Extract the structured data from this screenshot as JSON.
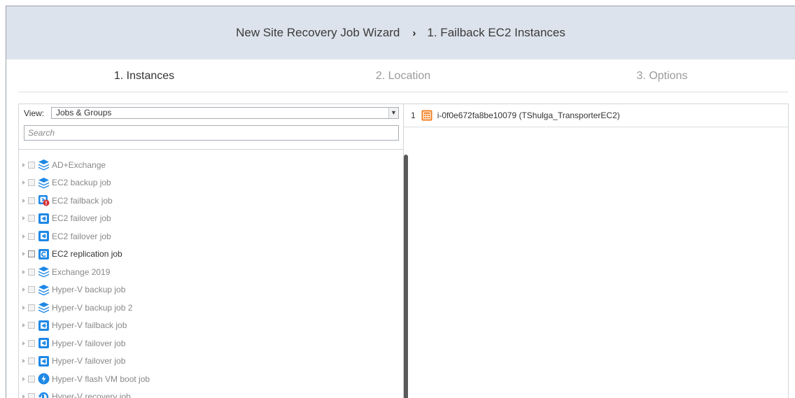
{
  "wizard": {
    "title": "New Site Recovery Job Wizard",
    "separator": "›",
    "subtitle": "1. Failback EC2 Instances"
  },
  "steps": [
    {
      "label": "1. Instances",
      "active": true
    },
    {
      "label": "2. Location",
      "active": false
    },
    {
      "label": "3. Options",
      "active": false
    }
  ],
  "left_pane": {
    "view_label": "View:",
    "view_value": "Jobs & Groups",
    "search_placeholder": "Search",
    "items": [
      {
        "label": "AD+Exchange",
        "icon": "stack-icon"
      },
      {
        "label": "EC2 backup job",
        "icon": "stack-icon"
      },
      {
        "label": "EC2 failback job",
        "icon": "failback-error-icon"
      },
      {
        "label": "EC2 failover job",
        "icon": "failover-icon"
      },
      {
        "label": "EC2 failover job",
        "icon": "failover-icon"
      },
      {
        "label": "EC2 replication job",
        "icon": "replication-icon"
      },
      {
        "label": "Exchange 2019",
        "icon": "stack-icon"
      },
      {
        "label": "Hyper-V backup job",
        "icon": "stack-icon"
      },
      {
        "label": "Hyper-V backup job 2",
        "icon": "stack-icon"
      },
      {
        "label": "Hyper-V failback job",
        "icon": "failover-icon"
      },
      {
        "label": "Hyper-V failover job",
        "icon": "failover-icon"
      },
      {
        "label": "Hyper-V failover job",
        "icon": "failover-icon"
      },
      {
        "label": "Hyper-V flash VM boot job",
        "icon": "flash-boot-icon"
      },
      {
        "label": "Hyper-V recovery job",
        "icon": "recovery-icon"
      }
    ]
  },
  "right_pane": {
    "items": [
      {
        "num": "1",
        "label": "i-0f0e672fa8be10079 (TShulga_TransporterEC2)",
        "icon": "ec2-instance-icon"
      }
    ]
  },
  "colors": {
    "header_bg": "#dde3ec",
    "icon_blue": "#1e88e5",
    "ec2_orange": "#f07c1a",
    "error_red": "#d32f2f"
  }
}
